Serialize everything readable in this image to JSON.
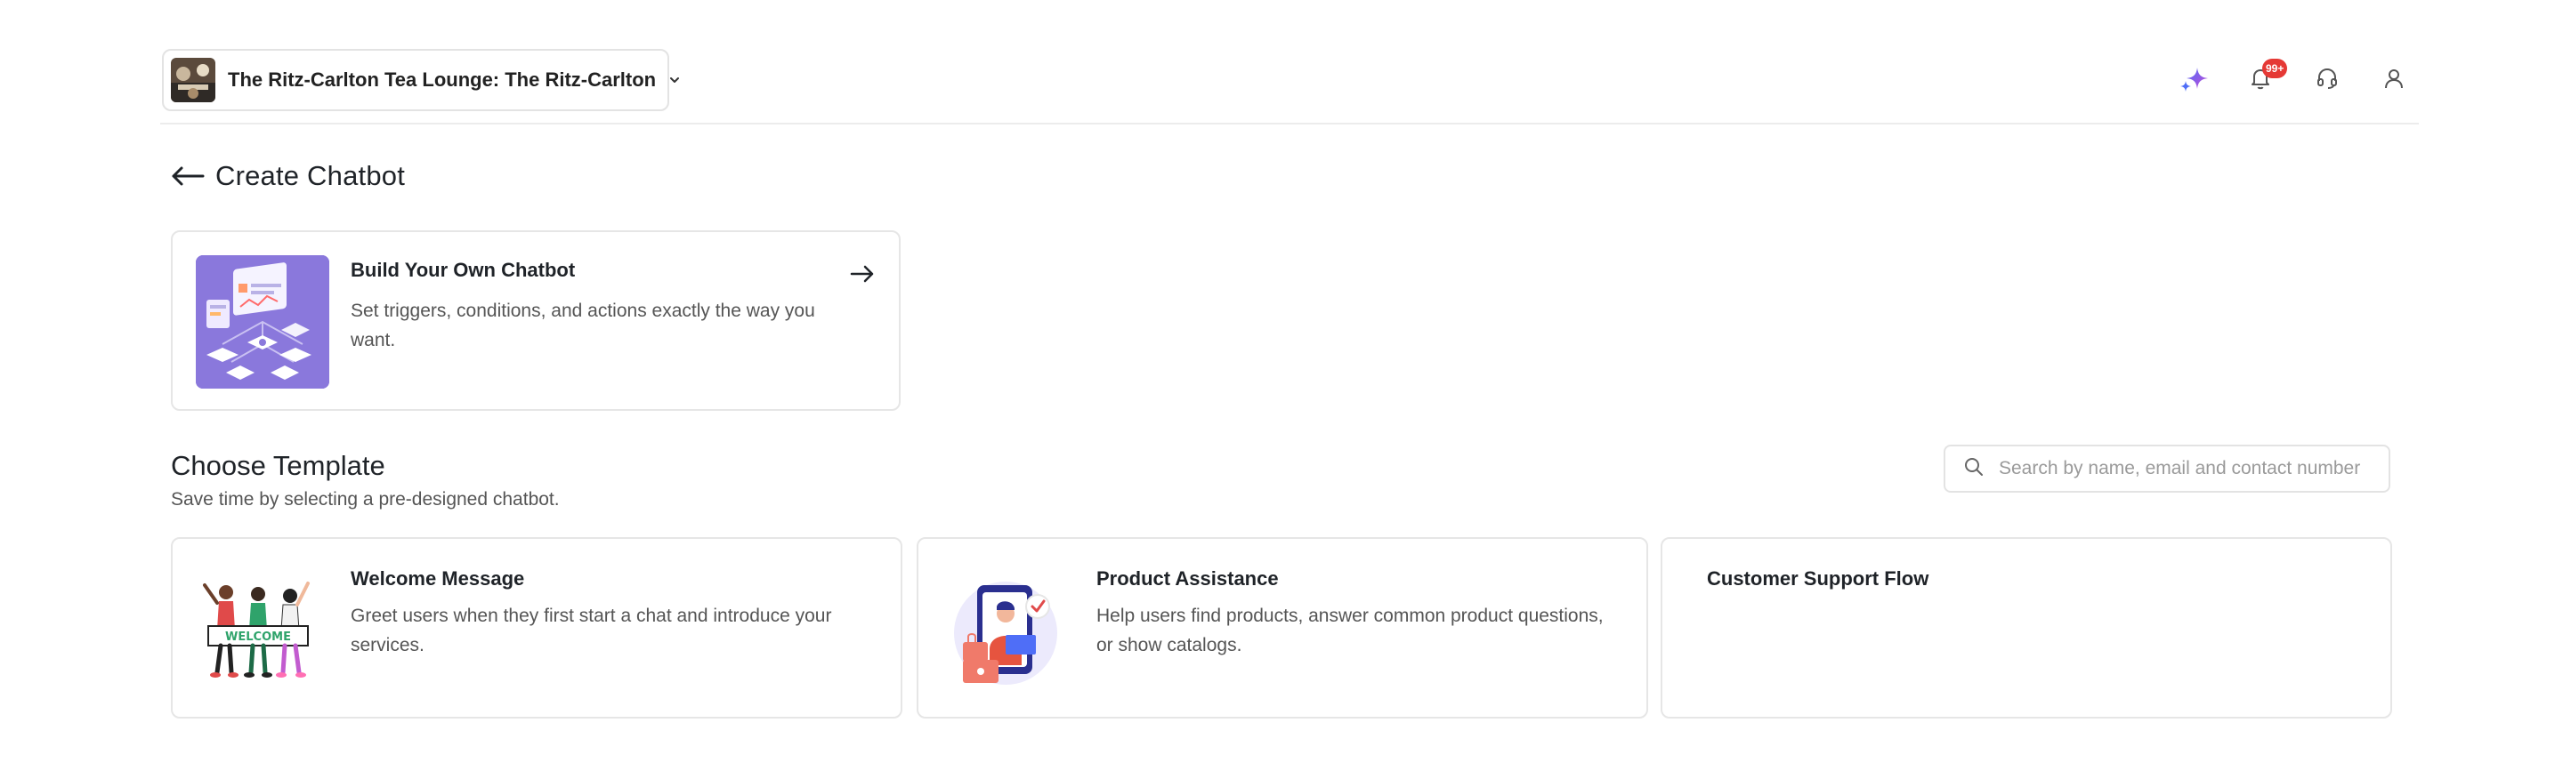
{
  "header": {
    "workspace_name": "The Ritz-Carlton Tea Lounge: The Ritz-Carlton",
    "notification_badge": "99+",
    "icons": [
      "ai-sparkle-icon",
      "bell-icon",
      "headset-icon",
      "user-icon"
    ]
  },
  "page": {
    "title": "Create Chatbot"
  },
  "build_card": {
    "title": "Build Your Own Chatbot",
    "description": "Set triggers, conditions, and actions exactly the way you want."
  },
  "templates_section": {
    "title": "Choose Template",
    "subtitle": "Save time by selecting a pre-designed chatbot.",
    "search_placeholder": "Search by name, email and contact number"
  },
  "templates": [
    {
      "title": "Welcome Message",
      "description": "Greet users when they first start a chat and introduce your services.",
      "illustration_text": "WELCOME"
    },
    {
      "title": "Product Assistance",
      "description": "Help users find products, answer common product questions, or show catalogs."
    },
    {
      "title": "Customer Support Flow",
      "description": ""
    }
  ],
  "colors": {
    "accent_purple": "#8a78dc",
    "badge_red": "#e53935",
    "sparkle_blue": "#4f6ef7",
    "sparkle_pink": "#c44bd8"
  }
}
